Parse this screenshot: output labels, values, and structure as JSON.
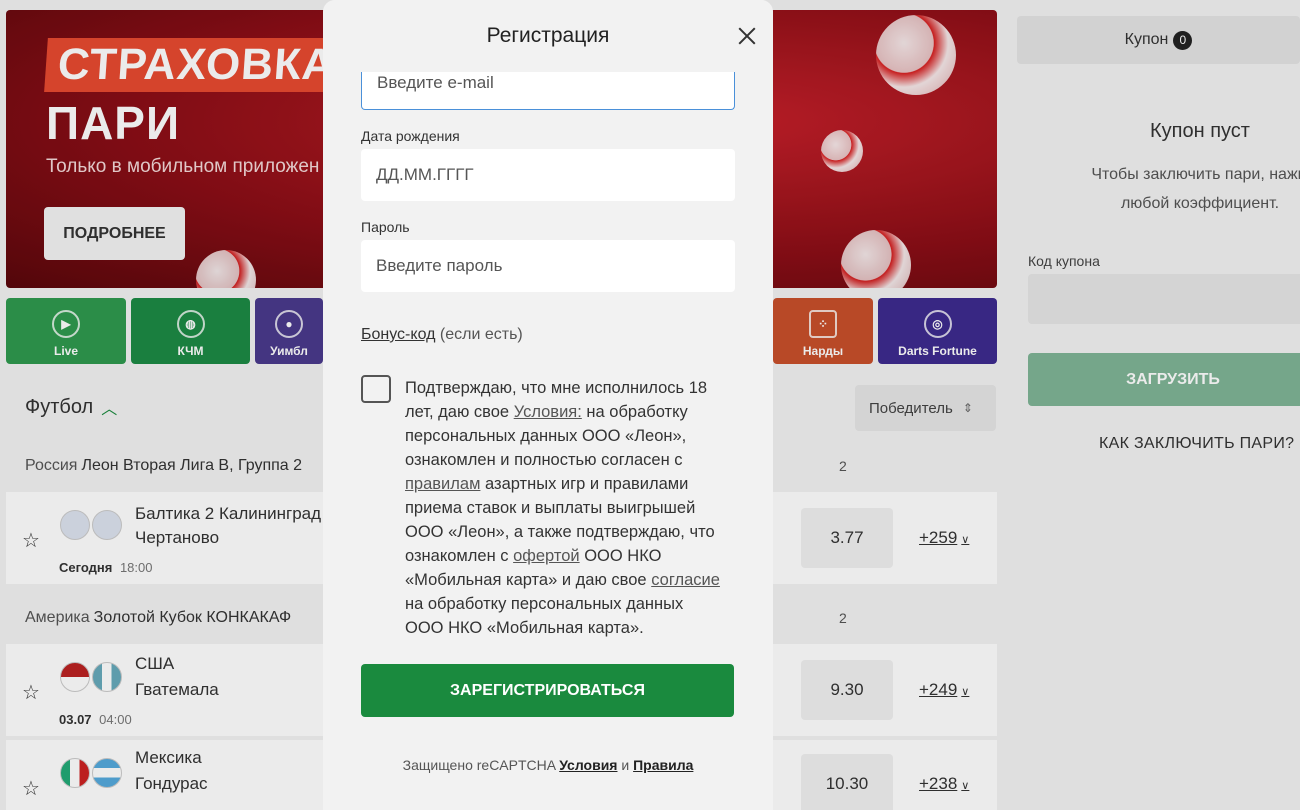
{
  "banner": {
    "title_line1": "СТРАХОВКА",
    "title_line2": "ПАРИ",
    "subtitle": "Только в мобильном приложен",
    "button": "ПОДРОБНЕЕ"
  },
  "categories": [
    {
      "label": "Live",
      "icon": "play-icon",
      "color": "#2f9a4f"
    },
    {
      "label": "КЧМ",
      "icon": "globe-icon",
      "color": "#1d8a45"
    },
    {
      "label": "Уимбл",
      "icon": "tennis-icon",
      "color": "#4a3a8c"
    },
    {
      "label": "Нарды",
      "icon": "dice-icon",
      "color": "#c8502b"
    },
    {
      "label": "Darts Fortune",
      "icon": "dartboard-icon",
      "color": "#3d2b8f"
    }
  ],
  "sport": {
    "title": "Футбол",
    "sort_label": "Победитель"
  },
  "leagues": [
    {
      "country": "Россия",
      "name": "Леон Вторая Лига B, Группа 2",
      "col": "2",
      "matches": [
        {
          "home": "Балтика 2 Калининград",
          "away": "Чертаново",
          "day": "Сегодня",
          "time": "18:00",
          "odd": "3.77",
          "more": "+259"
        }
      ]
    },
    {
      "country": "Америка",
      "name": "Золотой Кубок КОНКАКАФ",
      "col": "2",
      "matches": [
        {
          "home": "США",
          "away": "Гватемала",
          "day": "03.07",
          "time": "04:00",
          "odd": "9.30",
          "more": "+249"
        },
        {
          "home": "Мексика",
          "away": "Гондурас",
          "day": "",
          "time": "",
          "odd": "10.30",
          "more": "+238"
        }
      ]
    }
  ],
  "coupon": {
    "tab_label": "Купон",
    "count": "0",
    "empty_title": "Купон пуст",
    "empty_text_1": "Чтобы заключить пари, нажм",
    "empty_text_2": "любой коэффициент.",
    "code_label": "Код купона",
    "load_button": "ЗАГРУЗИТЬ",
    "howto": "КАК ЗАКЛЮЧИТЬ ПАРИ?"
  },
  "modal": {
    "title": "Регистрация",
    "email_placeholder": "Введите e-mail",
    "birth_label": "Дата рождения",
    "birth_placeholder": "ДД.ММ.ГГГГ",
    "password_label": "Пароль",
    "password_placeholder": "Введите пароль",
    "bonus_link": "Бонус-код",
    "bonus_suffix": "(если есть)",
    "consent": {
      "t1": "Подтверждаю, что мне исполнилось 18 лет, даю свое ",
      "l1": "Условия:",
      "t2": " на обработку персональных данных ООО «Леон», ознакомлен и полностью согласен с ",
      "l2": "правилам",
      "t3": " азартных игр и правилами приема ставок и выплаты выигрышей ООО «Леон», а также подтверждаю, что ознакомлен с ",
      "l3": "офертой",
      "t4": " ООО НКО «Мобильная карта» и даю свое ",
      "l4": "согласие",
      "t5": " на обработку персональных данных ООО НКО «Мобильная карта»."
    },
    "register_button": "ЗАРЕГИСТРИРОВАТЬСЯ",
    "recaptcha_prefix": "Защищено reCAPTCHA",
    "recaptcha_terms": "Условия",
    "recaptcha_and": "и",
    "recaptcha_rules": "Правила"
  }
}
